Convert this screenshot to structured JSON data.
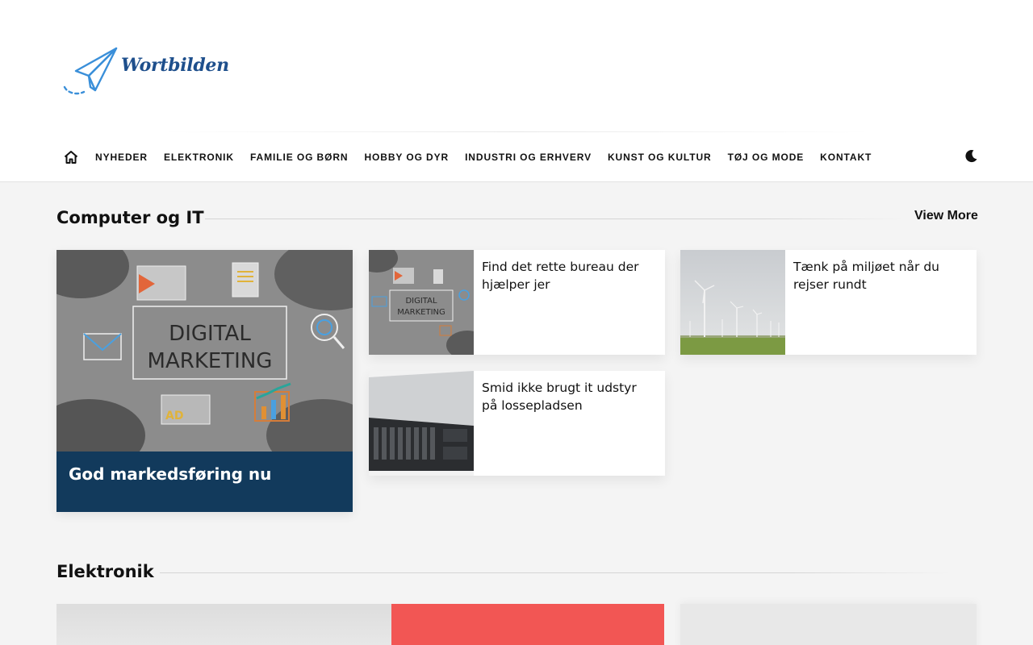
{
  "site": {
    "logo_text": "Wortbilden"
  },
  "nav": {
    "items": [
      {
        "label": "NYHEDER"
      },
      {
        "label": "ELEKTRONIK"
      },
      {
        "label": "FAMILIE OG BØRN"
      },
      {
        "label": "HOBBY OG DYR"
      },
      {
        "label": "INDUSTRI OG ERHVERV"
      },
      {
        "label": "KUNST OG KULTUR"
      },
      {
        "label": "TØJ OG MODE"
      },
      {
        "label": "KONTAKT"
      }
    ]
  },
  "sections": {
    "computer": {
      "title": "Computer og IT",
      "view_more": "View More",
      "featured": {
        "title": "God markedsføring nu",
        "image_text_line1": "DIGITAL",
        "image_text_line2": "MARKETING",
        "image_badge": "AD"
      },
      "cards": [
        {
          "title": "Find det rette bureau der hjælper jer",
          "image_text_line1": "DIGITAL",
          "image_text_line2": "MARKETING"
        },
        {
          "title": "Tænk på miljøet når du rejser rundt"
        },
        {
          "title": "Smid ikke brugt it udstyr på lossepladsen"
        }
      ]
    },
    "elektronik": {
      "title": "Elektronik"
    }
  },
  "colors": {
    "featured_caption_bg": "#123a5c",
    "logo_blue": "#1e4f8c",
    "accent_red": "#f25654",
    "page_bg": "#f4f4f4"
  }
}
